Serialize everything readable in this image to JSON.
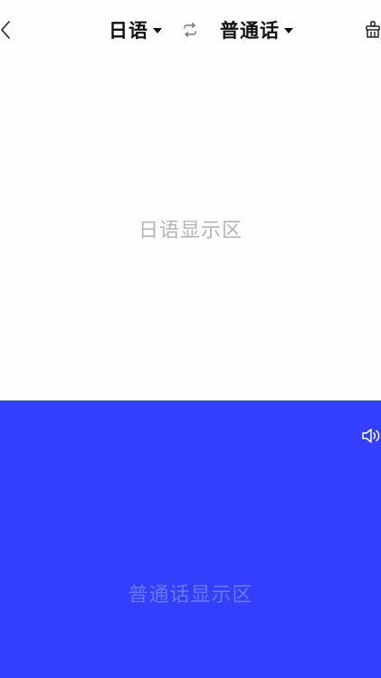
{
  "header": {
    "source_language": "日语",
    "target_language": "普通话",
    "back_icon": "chevron-left-icon",
    "swap_icon": "swap-icon",
    "clear_icon": "clear-brush-icon"
  },
  "source_panel": {
    "placeholder": "日语显示区",
    "background": "#fefefe"
  },
  "target_panel": {
    "placeholder": "普通话显示区",
    "background": "#3240fe",
    "speaker_icon": "speaker-icon"
  }
}
